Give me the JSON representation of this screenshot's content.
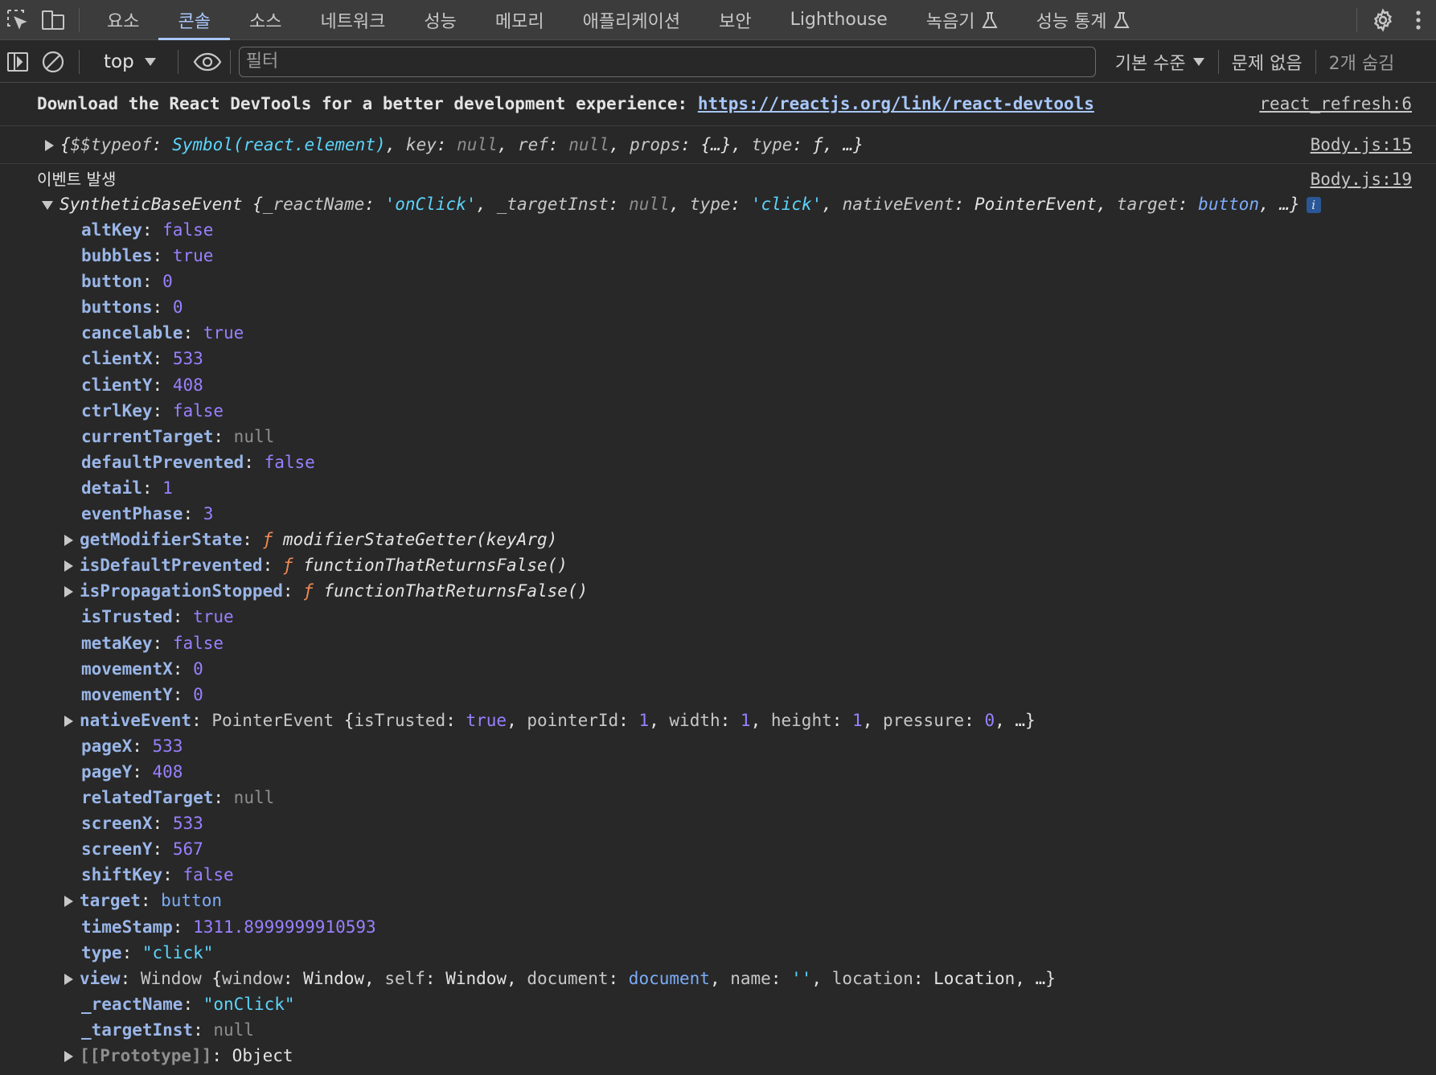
{
  "tabs": [
    {
      "label": "요소",
      "active": false,
      "experimental": false
    },
    {
      "label": "콘솔",
      "active": true,
      "experimental": false
    },
    {
      "label": "소스",
      "active": false,
      "experimental": false
    },
    {
      "label": "네트워크",
      "active": false,
      "experimental": false
    },
    {
      "label": "성능",
      "active": false,
      "experimental": false
    },
    {
      "label": "메모리",
      "active": false,
      "experimental": false
    },
    {
      "label": "애플리케이션",
      "active": false,
      "experimental": false
    },
    {
      "label": "보안",
      "active": false,
      "experimental": false
    },
    {
      "label": "Lighthouse",
      "active": false,
      "experimental": false
    },
    {
      "label": "녹음기",
      "active": false,
      "experimental": true
    },
    {
      "label": "성능 통계",
      "active": false,
      "experimental": true
    }
  ],
  "toolbar": {
    "context": "top",
    "filter_placeholder": "필터",
    "levels": "기본 수준",
    "issues": "문제 없음",
    "hidden": "2개 숨김"
  },
  "messages": {
    "devtools": {
      "text": "Download the React DevTools for a better development experience:",
      "url": "https://reactjs.org/link/react-devtools",
      "source": "react_refresh:6"
    },
    "element": {
      "source": "Body.js:15",
      "symbol": "Symbol(react.element)"
    },
    "event": {
      "label": "이벤트 발생",
      "source": "Body.js:19",
      "summary_name": "SyntheticBaseEvent",
      "properties": [
        {
          "key": "altKey",
          "value": "false",
          "kind": "bool"
        },
        {
          "key": "bubbles",
          "value": "true",
          "kind": "bool"
        },
        {
          "key": "button",
          "value": "0",
          "kind": "num"
        },
        {
          "key": "buttons",
          "value": "0",
          "kind": "num"
        },
        {
          "key": "cancelable",
          "value": "true",
          "kind": "bool"
        },
        {
          "key": "clientX",
          "value": "533",
          "kind": "num"
        },
        {
          "key": "clientY",
          "value": "408",
          "kind": "num"
        },
        {
          "key": "ctrlKey",
          "value": "false",
          "kind": "bool"
        },
        {
          "key": "currentTarget",
          "value": "null",
          "kind": "null"
        },
        {
          "key": "defaultPrevented",
          "value": "false",
          "kind": "bool"
        },
        {
          "key": "detail",
          "value": "1",
          "kind": "num"
        },
        {
          "key": "eventPhase",
          "value": "3",
          "kind": "num"
        },
        {
          "key": "getModifierState",
          "value": "modifierStateGetter(keyArg)",
          "kind": "fn",
          "expandable": true
        },
        {
          "key": "isDefaultPrevented",
          "value": "functionThatReturnsFalse()",
          "kind": "fn",
          "expandable": true
        },
        {
          "key": "isPropagationStopped",
          "value": "functionThatReturnsFalse()",
          "kind": "fn",
          "expandable": true
        },
        {
          "key": "isTrusted",
          "value": "true",
          "kind": "bool"
        },
        {
          "key": "metaKey",
          "value": "false",
          "kind": "bool"
        },
        {
          "key": "movementX",
          "value": "0",
          "kind": "num"
        },
        {
          "key": "movementY",
          "value": "0",
          "kind": "num"
        },
        {
          "key": "nativeEvent",
          "value": "PointerEvent",
          "kind": "nativeEvent",
          "expandable": true
        },
        {
          "key": "pageX",
          "value": "533",
          "kind": "num"
        },
        {
          "key": "pageY",
          "value": "408",
          "kind": "num"
        },
        {
          "key": "relatedTarget",
          "value": "null",
          "kind": "null"
        },
        {
          "key": "screenX",
          "value": "533",
          "kind": "num"
        },
        {
          "key": "screenY",
          "value": "567",
          "kind": "num"
        },
        {
          "key": "shiftKey",
          "value": "false",
          "kind": "bool"
        },
        {
          "key": "target",
          "value": "button",
          "kind": "obj",
          "expandable": true
        },
        {
          "key": "timeStamp",
          "value": "1311.8999999910593",
          "kind": "num"
        },
        {
          "key": "type",
          "value": "\"click\"",
          "kind": "str"
        },
        {
          "key": "view",
          "value": "Window",
          "kind": "view",
          "expandable": true
        },
        {
          "key": "_reactName",
          "value": "\"onClick\"",
          "kind": "str"
        },
        {
          "key": "_targetInst",
          "value": "null",
          "kind": "null"
        },
        {
          "key": "[[Prototype]]",
          "value": "Object",
          "kind": "proto",
          "expandable": true
        }
      ]
    }
  },
  "colors": {
    "background": "#282828",
    "tabbar": "#3c3c3c",
    "active_tab": "#a8c7fa",
    "number": "#9980ff",
    "string": "#5cd5fb",
    "function": "#f28b54",
    "property": "#9ab6e8",
    "null": "#8e8e8e"
  },
  "icons": {
    "inspect": "inspect-element-icon",
    "device": "device-toolbar-icon",
    "settings": "gear-icon",
    "more": "kebab-menu-icon",
    "sidebar": "sidebar-toggle-icon",
    "clear": "clear-console-icon",
    "eye": "live-expression-eye-icon"
  }
}
